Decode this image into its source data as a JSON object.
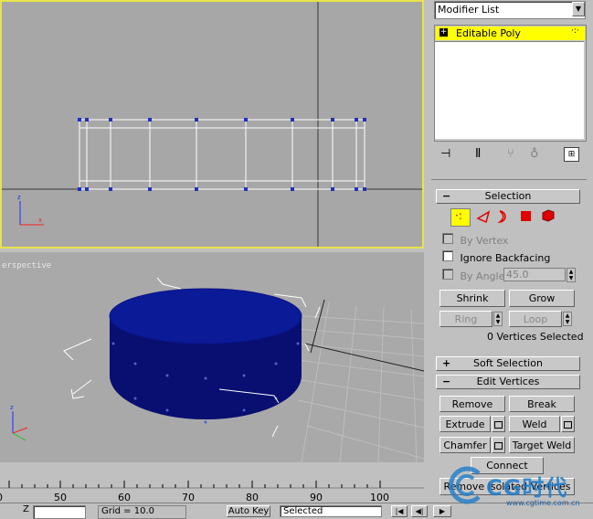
{
  "viewports": {
    "perspective_label": "erspective"
  },
  "modifier_panel": {
    "modifier_list_label": "Modifier List",
    "stack_item": "Editable Poly"
  },
  "selection": {
    "title": "Selection",
    "by_vertex": "By Vertex",
    "ignore_backfacing": "Ignore Backfacing",
    "by_angle": "By Angle:",
    "angle_value": "45.0",
    "shrink": "Shrink",
    "grow": "Grow",
    "ring": "Ring",
    "loop": "Loop",
    "status": "0 Vertices Selected"
  },
  "soft_selection": {
    "title": "Soft Selection"
  },
  "edit_vertices": {
    "title": "Edit Vertices",
    "remove": "Remove",
    "break": "Break",
    "extrude": "Extrude",
    "weld": "Weld",
    "chamfer": "Chamfer",
    "target_weld": "Target Weld",
    "connect": "Connect",
    "remove_isolated": "Remove Isolated Vertices"
  },
  "timeline": {
    "ticks": [
      "0",
      "50",
      "60",
      "70",
      "80",
      "90",
      "100"
    ]
  },
  "statusbar": {
    "z_label": "Z",
    "grid_text": "Grid = 10.0",
    "auto_key": "Auto Key",
    "selected": "Selected"
  },
  "watermark": {
    "brand": "CG时代",
    "url": "www.cgtime.com.cn"
  },
  "colors": {
    "active_border": "#e8e44a",
    "stack_highlight": "#ffff00",
    "object_blue": "#0b1280",
    "subobject_red": "#e00000"
  }
}
